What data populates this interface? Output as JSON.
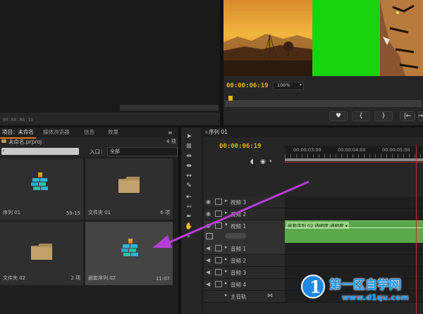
{
  "source_monitor": {
    "timecode": "00:00:06:19"
  },
  "program_monitor": {
    "timecode": "00:00:06:19",
    "zoom": "100%",
    "buttons": [
      "♥",
      "{",
      "}",
      "|←",
      "→|"
    ]
  },
  "project_panel": {
    "tabs": [
      "项目：未命名",
      "媒体浏览器",
      "信息",
      "效果"
    ],
    "project_file": "未命名.prproj",
    "item_count": "4 项",
    "entry_label": "入口：",
    "entry_value": "全部",
    "items": [
      {
        "name": "序列 01",
        "meta": "59:15",
        "icon": "sequence-icon"
      },
      {
        "name": "文件夹 01",
        "meta": "6 项",
        "icon": "folder-icon"
      },
      {
        "name": "文件夹 02",
        "meta": "2 项",
        "icon": "folder-icon"
      },
      {
        "name": "嵌套序列 02",
        "meta": "11:07",
        "icon": "sequence-icon"
      }
    ]
  },
  "timeline": {
    "tab": "序列 01",
    "timecode": "00:00:06:19",
    "ruler": [
      "00:00:03:00",
      "00:00:04:00",
      "00:00:05:00"
    ],
    "tracks": [
      {
        "label": "视频 3",
        "type": "video"
      },
      {
        "label": "视频 2",
        "type": "video"
      },
      {
        "label": "视频 1",
        "type": "video"
      },
      {
        "label": "音频 1",
        "type": "audio"
      },
      {
        "label": "音频 2",
        "type": "audio"
      },
      {
        "label": "音频 3",
        "type": "audio"
      },
      {
        "label": "音频 4",
        "type": "audio"
      },
      {
        "label": "主音轨",
        "type": "master"
      }
    ],
    "clip_label": "嵌套序列 02 透明度:透明度 ▾"
  },
  "watermark": {
    "logo_char": "1",
    "text": "第一区自学网",
    "url": "www.d1qu.com"
  },
  "colors": {
    "timecode": "#e8b200",
    "accent_orange": "#e07b1c",
    "annotation_arrow": "#b53fd6",
    "clip_green": "#5aa84a",
    "chroma_green": "#18d40e"
  }
}
